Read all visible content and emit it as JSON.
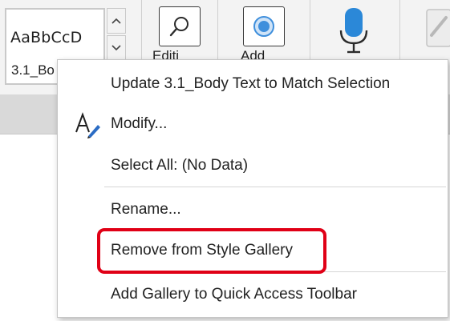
{
  "styles_gallery": {
    "preview_text": "AaBbCcD",
    "style_name": "3.1_Bo"
  },
  "ribbon": {
    "editing_label": "Editi",
    "addins_label": "Add",
    "dictate_label": "",
    "colors": {
      "mic_blue": "#2b88d8",
      "addin_blue": "#3f8fdc"
    }
  },
  "context_menu": {
    "items": [
      {
        "label": "Update 3.1_Body Text to Match Selection",
        "icon": ""
      },
      {
        "label": "Modify...",
        "icon": "modify-style-icon"
      },
      {
        "label": "Select All: (No Data)",
        "icon": ""
      },
      {
        "label": "Rename...",
        "icon": ""
      },
      {
        "label": "Remove from Style Gallery",
        "icon": ""
      },
      {
        "label": "Add Gallery to Quick Access Toolbar",
        "icon": ""
      }
    ],
    "highlighted_item": "Remove from Style Gallery",
    "highlight_color": "#e00016"
  }
}
